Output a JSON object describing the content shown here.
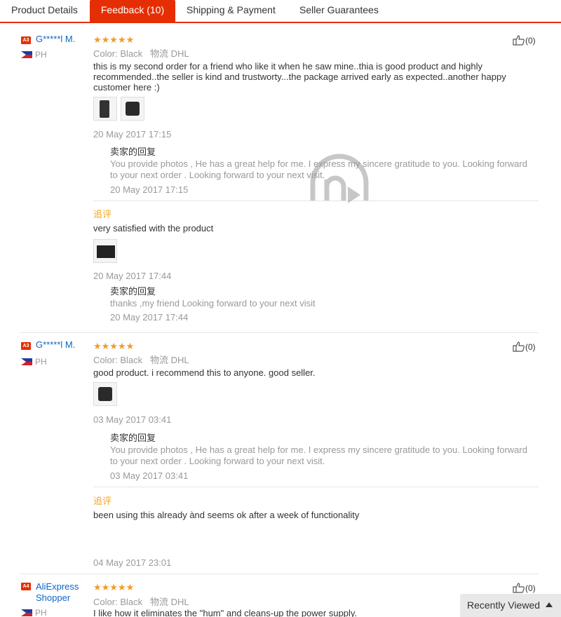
{
  "tabs": [
    {
      "label": "Product Details",
      "active": false
    },
    {
      "label": "Feedback (10)",
      "active": true
    },
    {
      "label": "Shipping & Payment",
      "active": false
    },
    {
      "label": "Seller Guarantees",
      "active": false
    }
  ],
  "reviews": [
    {
      "level": "A3",
      "user": "G*****l M.",
      "country": "PH",
      "rating": 5,
      "stars": "★★★★★",
      "color_label": "Color:",
      "color_value": "Black",
      "shipping_label": "物流",
      "shipping_value": "DHL",
      "text": "this is my second order for a friend who like it when he saw mine..thia is good product and highly recommended..the seller is kind and trustworty...the package arrived early as expected..another happy customer here :)",
      "date": "20 May 2017 17:15",
      "likes": "(0)",
      "seller_reply": {
        "title": "卖家的回复",
        "text": "You provide photos , He has a great help for me. I express my sincere gratitude to you. Looking forward to your next order . Looking forward to your next visit.",
        "date": "20 May 2017 17:15"
      },
      "additional": {
        "label": "追评",
        "text": "very satisfied with the product",
        "date": "20 May 2017 17:44",
        "seller_reply": {
          "title": "卖家的回复",
          "text": "thanks ,my friend Looking forward to your next visit",
          "date": "20 May 2017 17:44"
        }
      }
    },
    {
      "level": "A3",
      "user": "G*****l M.",
      "country": "PH",
      "rating": 5,
      "stars": "★★★★★",
      "color_label": "Color:",
      "color_value": "Black",
      "shipping_label": "物流",
      "shipping_value": "DHL",
      "text": "good product. i recommend this to anyone. good seller.",
      "date": "03 May 2017 03:41",
      "likes": "(0)",
      "seller_reply": {
        "title": "卖家的回复",
        "text": "You provide photos , He has a great help for me. I express my sincere gratitude to you. Looking forward to your next order . Looking forward to your next visit.",
        "date": "03 May 2017 03:41"
      },
      "additional": {
        "label": "追评",
        "text": "been using this already ànd seems ok after a week of functionality",
        "date": "04 May 2017 23:01"
      }
    },
    {
      "level": "A4",
      "user": "AliExpress Shopper",
      "country": "PH",
      "rating": 5,
      "stars": "★★★★★",
      "color_label": "Color:",
      "color_value": "Black",
      "shipping_label": "物流",
      "shipping_value": "DHL",
      "text": "I like how it eliminates the \"hum\" and cleans-up the power supply.",
      "likes": "(0)"
    }
  ],
  "recently_viewed": "Recently Viewed"
}
